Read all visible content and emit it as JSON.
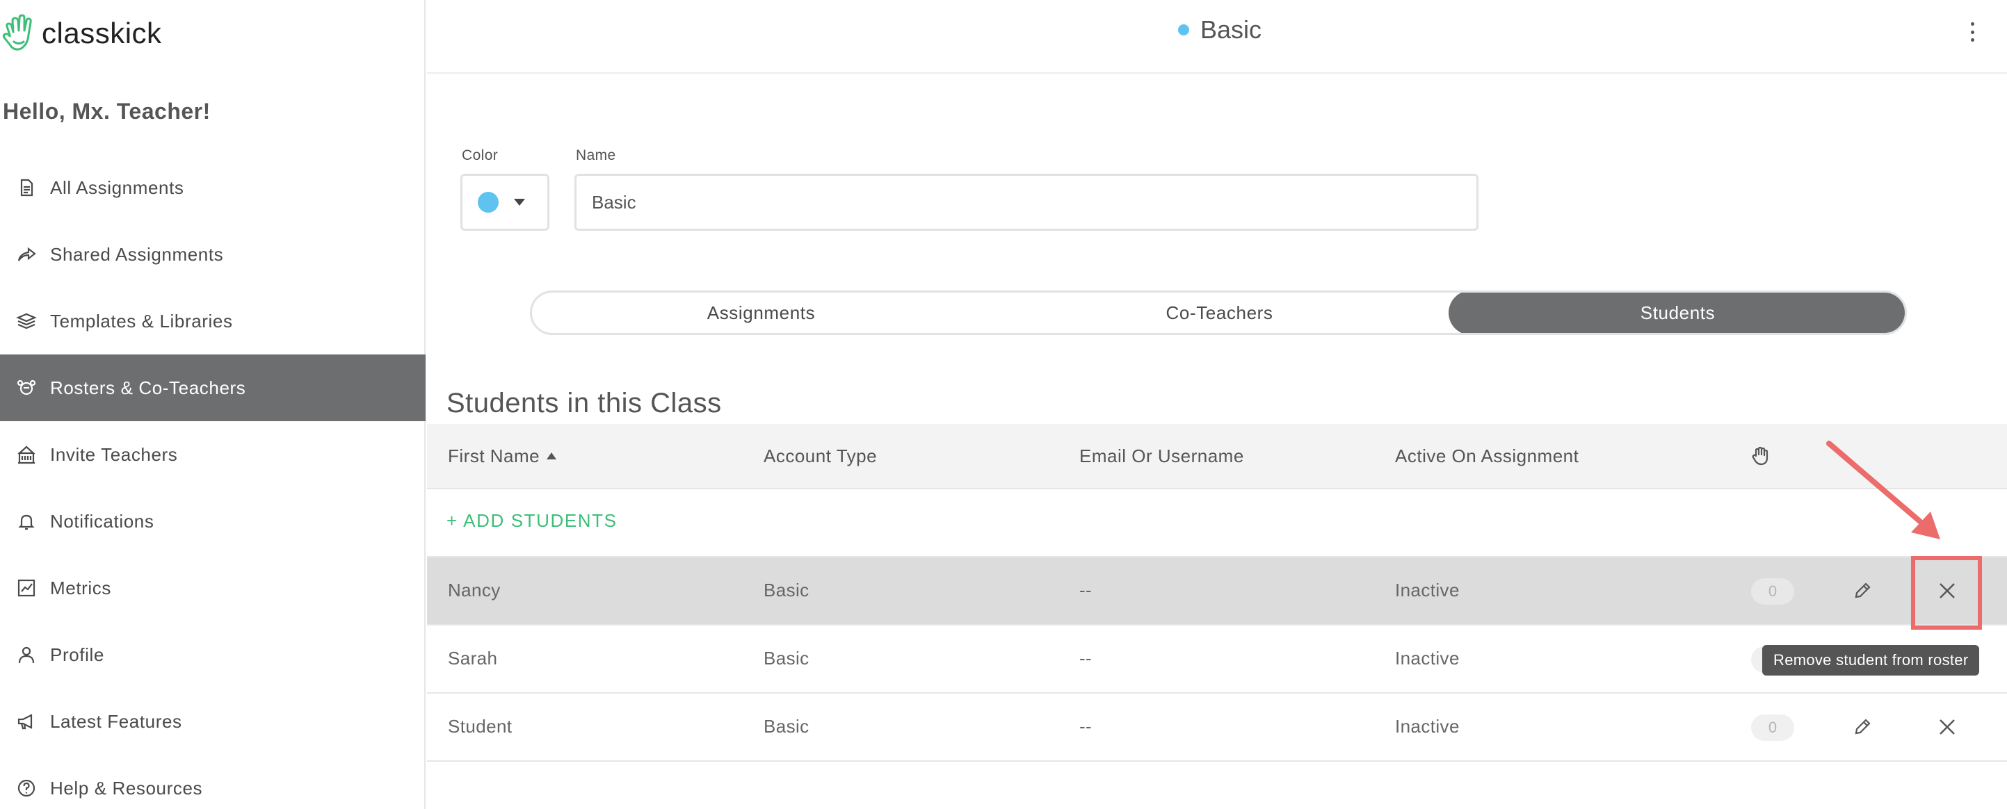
{
  "app": {
    "logo_text": "classkick",
    "greeting": "Hello, Mx. Teacher!"
  },
  "sidebar": {
    "items": [
      {
        "label": "All Assignments",
        "icon": "document-icon",
        "active": false
      },
      {
        "label": "Shared Assignments",
        "icon": "share-arrow-icon",
        "active": false
      },
      {
        "label": "Templates & Libraries",
        "icon": "layers-icon",
        "active": false
      },
      {
        "label": "Rosters & Co-Teachers",
        "icon": "roster-icon",
        "active": true
      },
      {
        "label": "Invite Teachers",
        "icon": "school-icon",
        "active": false
      },
      {
        "label": "Notifications",
        "icon": "bell-icon",
        "active": false
      },
      {
        "label": "Metrics",
        "icon": "chart-icon",
        "active": false
      },
      {
        "label": "Profile",
        "icon": "person-icon",
        "active": false
      },
      {
        "label": "Latest Features",
        "icon": "megaphone-icon",
        "active": false
      },
      {
        "label": "Help & Resources",
        "icon": "help-icon",
        "active": false
      }
    ]
  },
  "header": {
    "title": "Basic",
    "dot_color": "#5fc3ef"
  },
  "form": {
    "color_label": "Color",
    "color_value": "#5fc3ef",
    "name_label": "Name",
    "name_value": "Basic"
  },
  "tabs": [
    {
      "label": "Assignments",
      "active": false
    },
    {
      "label": "Co-Teachers",
      "active": false
    },
    {
      "label": "Students",
      "active": true
    }
  ],
  "section": {
    "title": "Students in this Class"
  },
  "table": {
    "columns": {
      "first_name": "First Name",
      "account_type": "Account Type",
      "email": "Email Or Username",
      "active": "Active On Assignment"
    },
    "add_students": "+ ADD STUDENTS",
    "rows": [
      {
        "first_name": "Nancy",
        "account_type": "Basic",
        "email": "--",
        "active": "Inactive",
        "count": "0"
      },
      {
        "first_name": "Sarah",
        "account_type": "Basic",
        "email": "--",
        "active": "Inactive",
        "count": "0"
      },
      {
        "first_name": "Student",
        "account_type": "Basic",
        "email": "--",
        "active": "Inactive",
        "count": "0"
      }
    ]
  },
  "tooltip": {
    "text": "Remove student from roster"
  },
  "colors": {
    "accent_green": "#3cbf78",
    "active_gray": "#6d6e70",
    "highlight_red": "#ec6b6b"
  }
}
